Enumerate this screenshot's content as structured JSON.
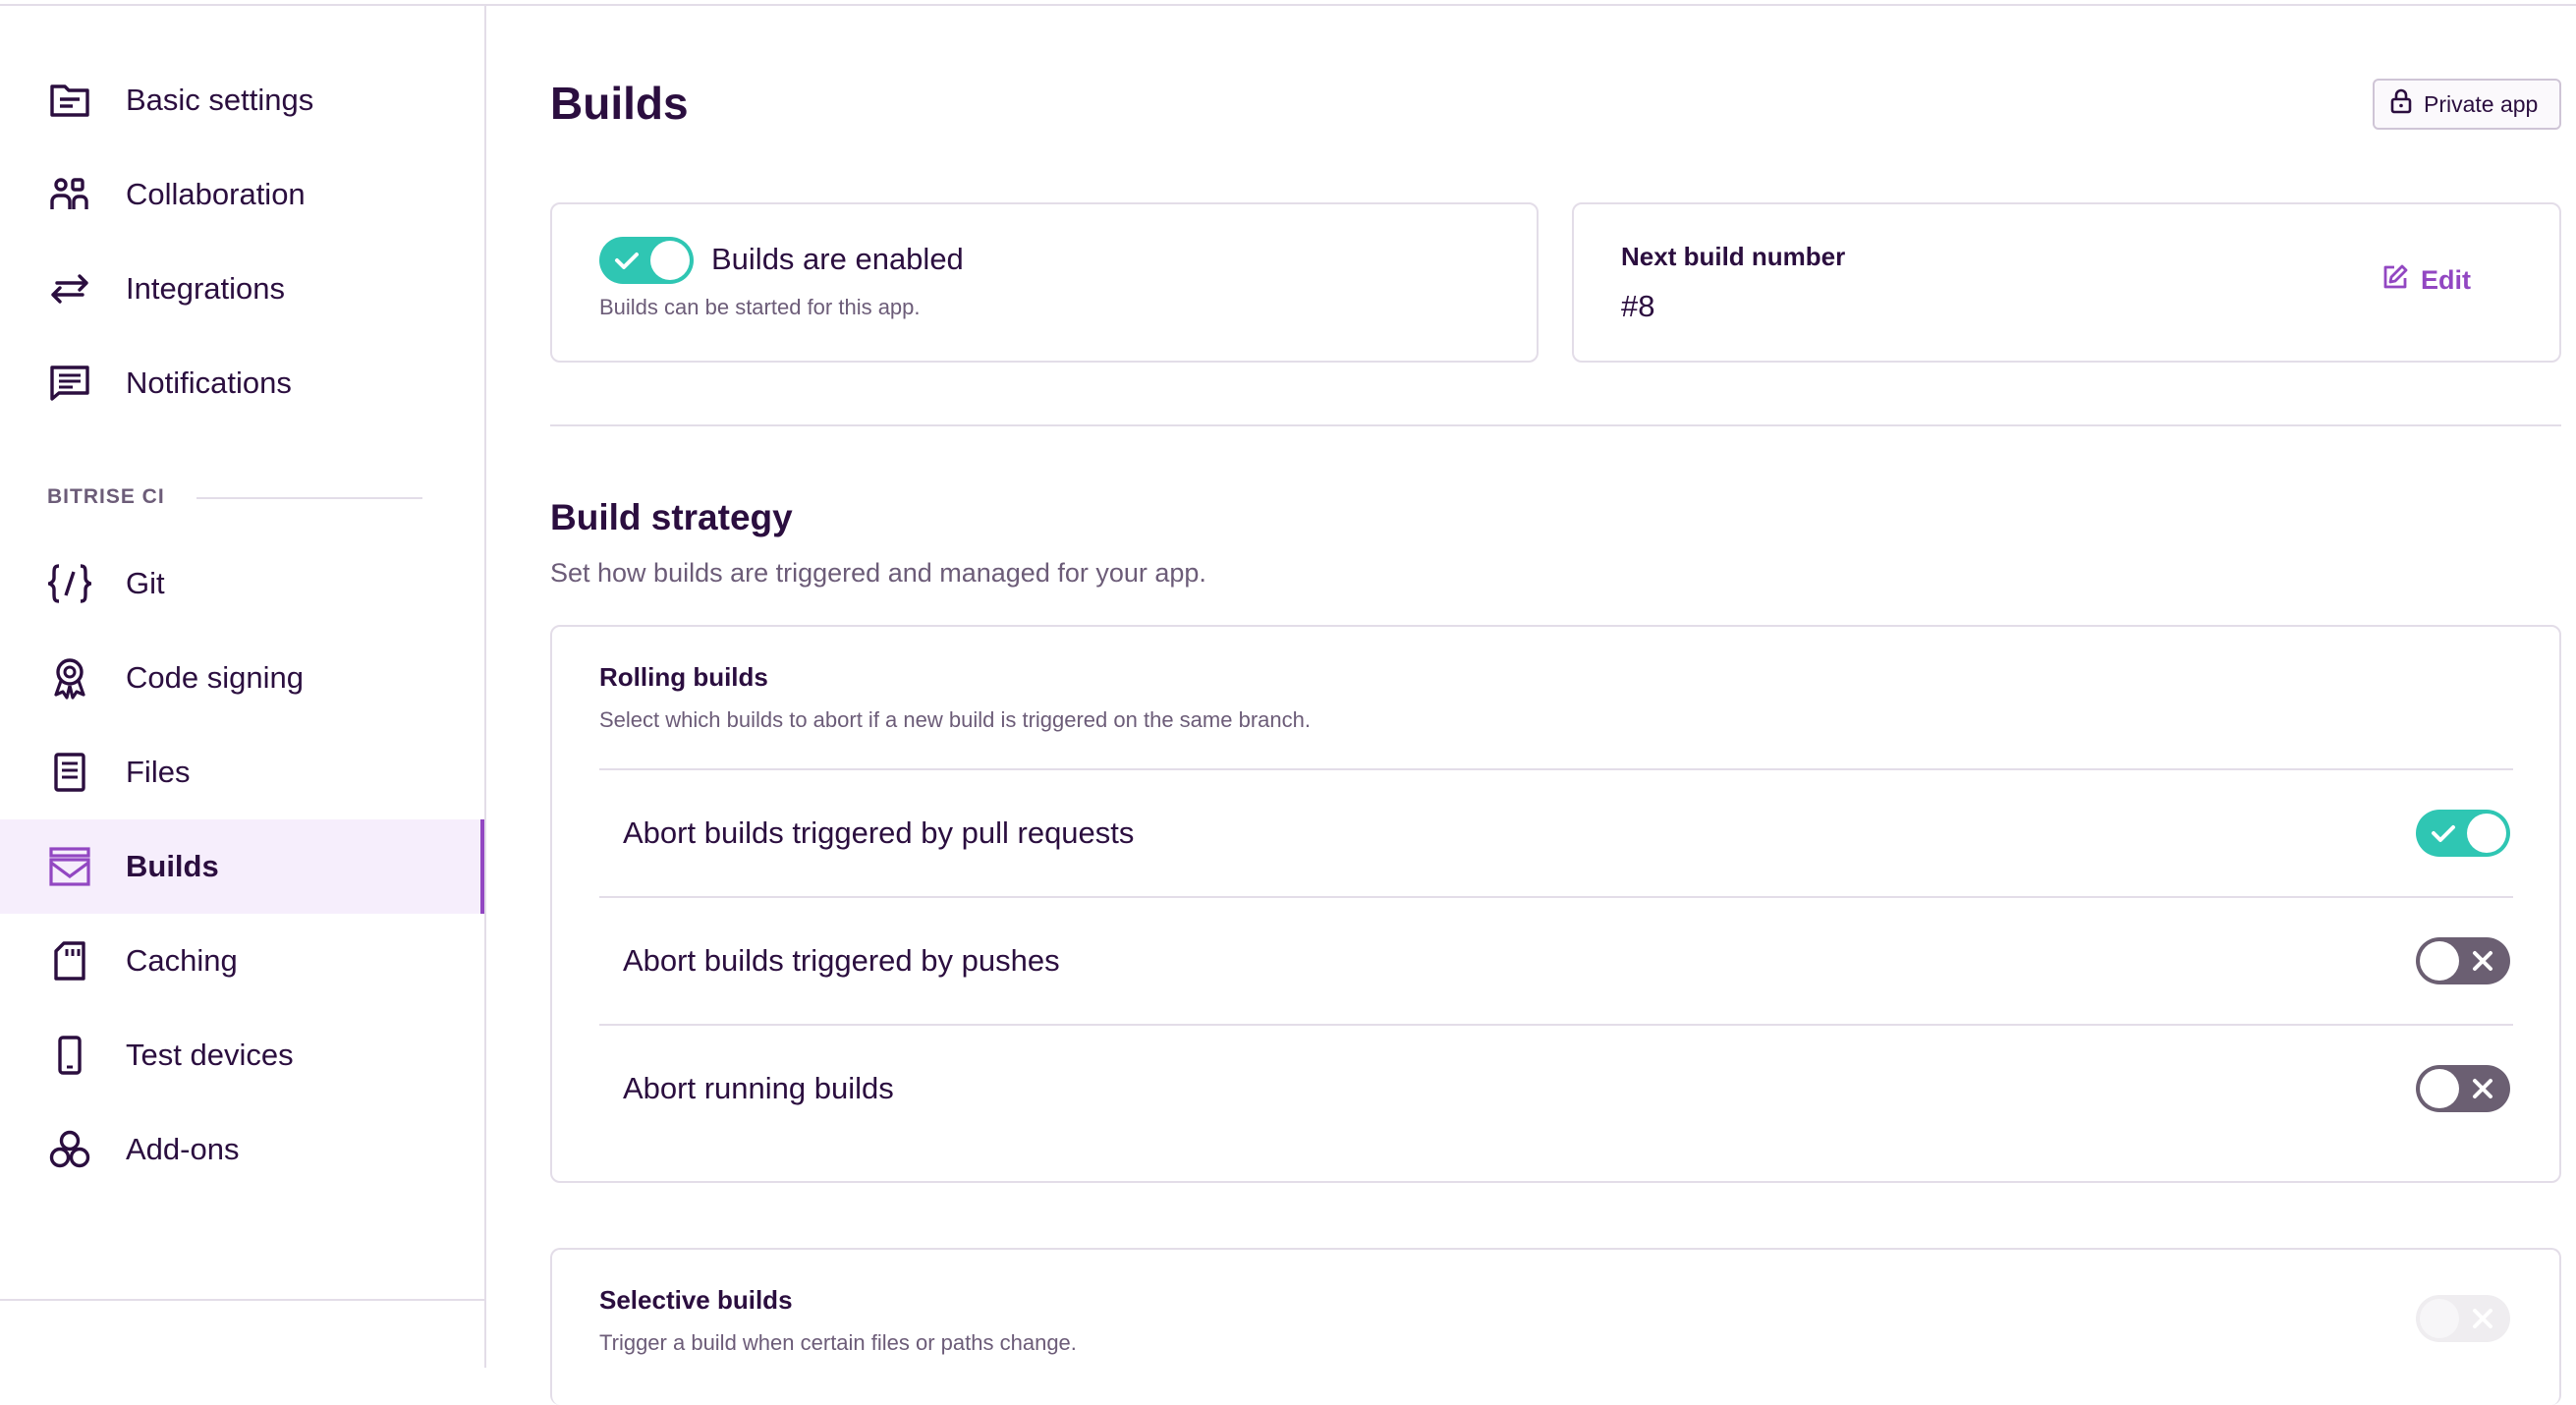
{
  "sidebar": {
    "items": [
      {
        "label": "Basic settings",
        "icon": "folder-icon"
      },
      {
        "label": "Collaboration",
        "icon": "people-icon"
      },
      {
        "label": "Integrations",
        "icon": "arrows-icon"
      },
      {
        "label": "Notifications",
        "icon": "message-icon"
      }
    ],
    "section_label": "BITRISE CI",
    "ci_items": [
      {
        "label": "Git",
        "icon": "code-braces-icon"
      },
      {
        "label": "Code signing",
        "icon": "badge-icon"
      },
      {
        "label": "Files",
        "icon": "file-icon"
      },
      {
        "label": "Builds",
        "icon": "builds-icon",
        "active": true
      },
      {
        "label": "Caching",
        "icon": "sd-card-icon"
      },
      {
        "label": "Test devices",
        "icon": "phone-icon"
      },
      {
        "label": "Add-ons",
        "icon": "addons-icon"
      }
    ]
  },
  "main": {
    "title": "Builds",
    "private_label": "Private app",
    "builds_enabled": {
      "title": "Builds are enabled",
      "subtitle": "Builds can be started for this app.",
      "on": true
    },
    "next_build": {
      "label": "Next build number",
      "value": "#8",
      "edit_label": "Edit"
    },
    "strategy": {
      "title": "Build strategy",
      "subtitle": "Set how builds are triggered and managed for your app.",
      "rolling": {
        "title": "Rolling builds",
        "subtitle": "Select which builds to abort if a new build is triggered on the same branch.",
        "options": [
          {
            "label": "Abort builds triggered by pull requests",
            "on": true
          },
          {
            "label": "Abort builds triggered by pushes",
            "on": false
          },
          {
            "label": "Abort running builds",
            "on": false
          }
        ]
      },
      "selective": {
        "title": "Selective builds",
        "subtitle": "Trigger a build when certain files or paths change.",
        "on": false,
        "disabled": true
      }
    }
  },
  "colors": {
    "accent": "#9247c2",
    "toggle_on": "#2fc6b3",
    "toggle_off": "#6b5f72",
    "text": "#2b0e3f",
    "muted": "#6c5c78"
  }
}
